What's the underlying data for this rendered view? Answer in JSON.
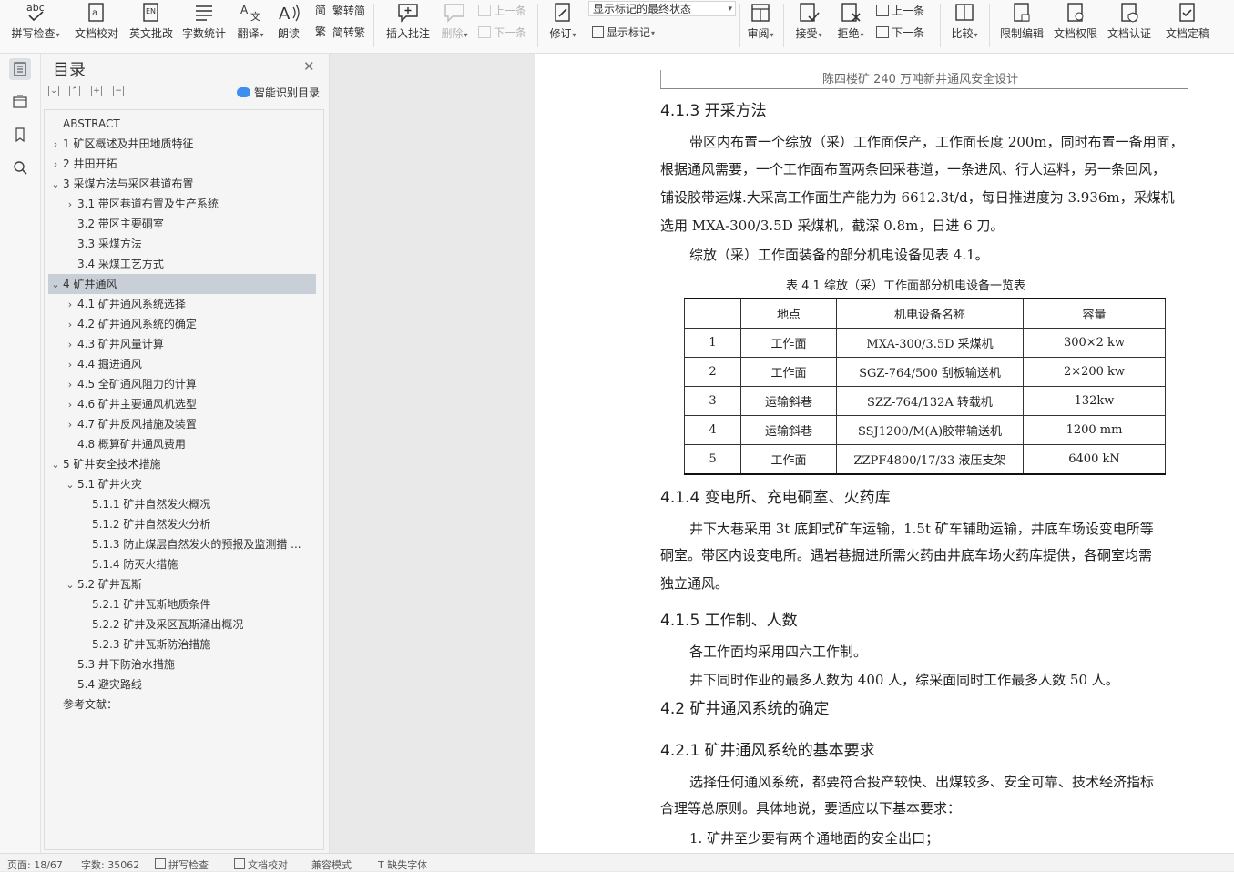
{
  "ribbon": {
    "spell_check": "拼写检查",
    "doc_proof": "文档校对",
    "en_review": "英文批改",
    "word_count": "字数统计",
    "translate": "翻译",
    "read_aloud": "朗读",
    "to_traditional": "繁转简",
    "to_simplified": "简转繁",
    "insert_comment": "插入批注",
    "delete": "删除",
    "prev": "上一条",
    "next": "下一条",
    "track_changes": "修订",
    "markup_state": "显示标记的最终状态",
    "show_markup": "显示标记",
    "review_pane": "审阅",
    "accept": "接受",
    "reject": "拒绝",
    "prev2": "上一条",
    "next2": "下一条",
    "compare": "比较",
    "restrict_edit": "限制编辑",
    "doc_permission": "文档权限",
    "doc_certify": "文档认证",
    "doc_finalize": "文档定稿",
    "abc": "abc"
  },
  "toc": {
    "title": "目录",
    "smart_label": "智能识别目录",
    "items": [
      {
        "label": "ABSTRACT",
        "arrow": ""
      },
      {
        "label": "1  矿区概述及井田地质特征",
        "arrow": "›"
      },
      {
        "label": "2  井田开拓",
        "arrow": "›"
      },
      {
        "label": "3  采煤方法与采区巷道布置",
        "arrow": "⌄"
      },
      {
        "label": "3.1 带区巷道布置及生产系统",
        "arrow": "›"
      },
      {
        "label": "3.2 带区主要硐室",
        "arrow": ""
      },
      {
        "label": "3.3 采煤方法",
        "arrow": ""
      },
      {
        "label": "3.4 采煤工艺方式",
        "arrow": ""
      },
      {
        "label": "4  矿井通风",
        "arrow": "⌄"
      },
      {
        "label": "4.1  矿井通风系统选择",
        "arrow": "›"
      },
      {
        "label": "4.2 矿井通风系统的确定",
        "arrow": "›"
      },
      {
        "label": "4.3 矿井风量计算",
        "arrow": "›"
      },
      {
        "label": "4.4  掘进通风",
        "arrow": "›"
      },
      {
        "label": "4.5 全矿通风阻力的计算",
        "arrow": "›"
      },
      {
        "label": "4.6  矿井主要通风机选型",
        "arrow": "›"
      },
      {
        "label": "4.7  矿井反风措施及装置",
        "arrow": "›"
      },
      {
        "label": "4.8 概算矿井通风费用",
        "arrow": ""
      },
      {
        "label": "5  矿井安全技术措施",
        "arrow": "⌄"
      },
      {
        "label": "5.1  矿井火灾",
        "arrow": "⌄"
      },
      {
        "label": "5.1.1  矿井自然发火概况",
        "arrow": ""
      },
      {
        "label": "5.1.2  矿井自然发火分析",
        "arrow": ""
      },
      {
        "label": "5.1.3  防止煤层自然发火的预报及监测措 ...",
        "arrow": ""
      },
      {
        "label": "5.1.4  防灭火措施",
        "arrow": ""
      },
      {
        "label": "5.2  矿井瓦斯",
        "arrow": "⌄"
      },
      {
        "label": "5.2.1  矿井瓦斯地质条件",
        "arrow": ""
      },
      {
        "label": "5.2.2  矿井及采区瓦斯涌出概况",
        "arrow": ""
      },
      {
        "label": "5.2.3  矿井瓦斯防治措施",
        "arrow": ""
      },
      {
        "label": "5.3 井下防治水措施",
        "arrow": ""
      },
      {
        "label": "5.4  避灾路线",
        "arrow": ""
      },
      {
        "label": "参考文献：",
        "arrow": ""
      }
    ]
  },
  "doc": {
    "header": "陈四楼矿 240 万吨新井通风安全设计",
    "h_413": "4.1.3 开采方法",
    "p1_l1": "带区内布置一个综放（采）工作面保产，工作面长度 200m，同时布置一备用面，",
    "p1_l2": "根据通风需要，一个工作面布置两条回采巷道，一条进风、行人运料，另一条回风，",
    "p1_l3": "铺设胶带运煤.大采高工作面生产能力为 6612.3t/d，每日推进度为 3.936m，采煤机",
    "p1_l4": "选用 MXA-300/3.5D 采煤机，截深 0.8m，日进 6 刀。",
    "p2": "综放（采）工作面装备的部分机电设备见表 4.1。",
    "table_caption": "表 4.1      综放（采）工作面部分机电设备一览表",
    "table": {
      "headers": [
        "",
        "地点",
        "机电设备名称",
        "容量"
      ],
      "rows": [
        [
          "1",
          "工作面",
          "MXA-300/3.5D 采煤机",
          "300×2 kw"
        ],
        [
          "2",
          "工作面",
          "SGZ-764/500 刮板输送机",
          "2×200 kw"
        ],
        [
          "3",
          "运输斜巷",
          "SZZ-764/132A 转载机",
          "132kw"
        ],
        [
          "4",
          "运输斜巷",
          "SSJ1200/M(A)胶带输送机",
          "1200 mm"
        ],
        [
          "5",
          "工作面",
          "ZZPF4800/17/33 液压支架",
          "6400 kN"
        ]
      ]
    },
    "h_414": "4.1.4 变电所、充电硐室、火药库",
    "p3_l1": "井下大巷采用 3t 底卸式矿车运输，1.5t 矿车辅助运输，井底车场设变电所等",
    "p3_l2": "硐室。带区内设变电所。遇岩巷掘进所需火药由井底车场火药库提供，各硐室均需",
    "p3_l3": "独立通风。",
    "h_415": "4.1.5 工作制、人数",
    "p4": "各工作面均采用四六工作制。",
    "p5": "井下同时作业的最多人数为 400 人，综采面同时工作最多人数 50 人。",
    "h_42": "4.2 矿井通风系统的确定",
    "h_421": "4.2.1 矿井通风系统的基本要求",
    "p6_l1": "选择任何通风系统，都要符合投产较快、出煤较多、安全可靠、技术经济指标",
    "p6_l2": "合理等总原则。具体地说，要适应以下基本要求：",
    "p7": "1. 矿井至少要有两个通地面的安全出口；"
  },
  "status": {
    "page": "页面: 18/67",
    "words": "字数: 35062",
    "spell": "拼写检查",
    "proof": "文档校对",
    "compat": "兼容模式",
    "missing_font": "缺失字体"
  }
}
